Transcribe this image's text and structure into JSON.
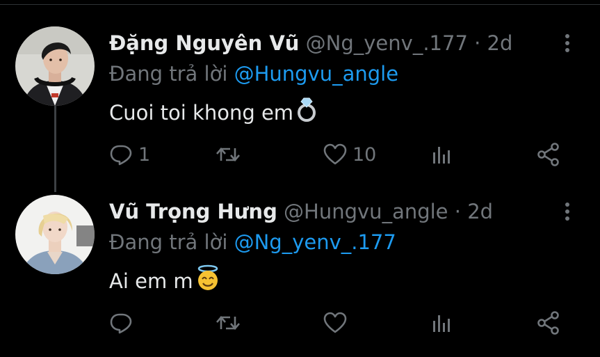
{
  "tweets": [
    {
      "display_name": "Đặng Nguyên Vũ",
      "handle": "@Ng_yenv_.177",
      "separator": "·",
      "time": "2d",
      "reply_prefix": "Đang trả lời",
      "reply_to": "@Hungvu_angle",
      "text": "Cuoi toi khong em",
      "emoji": "ring-emoji",
      "replies": "1",
      "likes": "10"
    },
    {
      "display_name": "Vũ Trọng Hưng",
      "handle": "@Hungvu_angle",
      "separator": "·",
      "time": "2d",
      "reply_prefix": "Đang trả lời",
      "reply_to": "@Ng_yenv_.177",
      "text": "Ai em m",
      "emoji": "smiling-face-with-halo-emoji",
      "replies": "",
      "likes": ""
    }
  ],
  "colors": {
    "background": "#000000",
    "text": "#e7e9ea",
    "secondary": "#71767b",
    "link": "#1d9bf0",
    "thread_line": "#3d4145"
  },
  "icons": [
    "reply-icon",
    "retweet-icon",
    "like-icon",
    "analytics-icon",
    "share-icon",
    "more-icon"
  ]
}
